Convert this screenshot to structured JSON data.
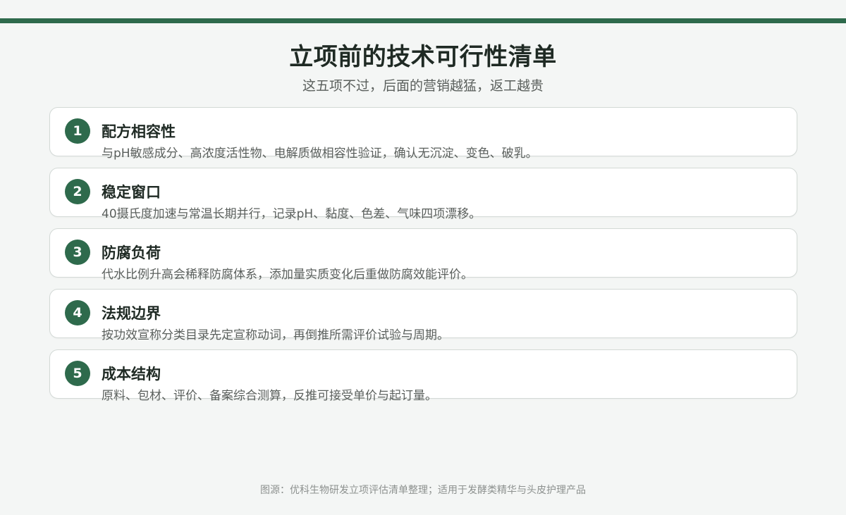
{
  "header": {
    "title": "立项前的技术可行性清单",
    "subtitle": "这五项不过，后面的营销越猛，返工越贵"
  },
  "items": [
    {
      "number": "1",
      "title": "配方相容性",
      "description": "与pH敏感成分、高浓度活性物、电解质做相容性验证，确认无沉淀、变色、破乳。"
    },
    {
      "number": "2",
      "title": "稳定窗口",
      "description": "40摄氏度加速与常温长期并行，记录pH、黏度、色差、气味四项漂移。"
    },
    {
      "number": "3",
      "title": "防腐负荷",
      "description": "代水比例升高会稀释防腐体系，添加量实质变化后重做防腐效能评价。"
    },
    {
      "number": "4",
      "title": "法规边界",
      "description": "按功效宣称分类目录先定宣称动词，再倒推所需评价试验与周期。"
    },
    {
      "number": "5",
      "title": "成本结构",
      "description": "原料、包材、评价、备案综合测算，反推可接受单价与起订量。"
    }
  ],
  "footer": {
    "source": "图源：优科生物研发立项评估清单整理；适用于发酵类精华与头皮护理产品"
  },
  "colors": {
    "accent": "#2e6a4c",
    "background": "#f4f6f5",
    "card": "#ffffff",
    "border": "#d3d9d6",
    "title_text": "#1f2a24",
    "body_text": "#5a5f5c"
  }
}
